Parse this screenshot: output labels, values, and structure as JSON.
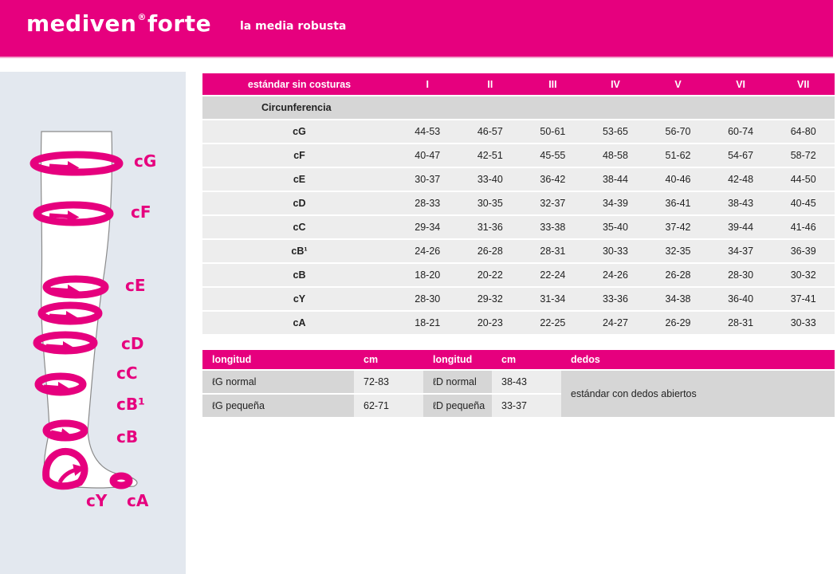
{
  "header": {
    "brand_main": "mediven",
    "brand_mark": "®",
    "brand_sub": "forte",
    "tagline": "la media robusta",
    "accent_color": "#e6007e"
  },
  "leg_labels": [
    "cG",
    "cF",
    "cE",
    "cD",
    "cC",
    "cB¹",
    "cB",
    "cY",
    "cA"
  ],
  "size_table": {
    "header_label": "estándar sin costuras",
    "sizes": [
      "I",
      "II",
      "III",
      "IV",
      "V",
      "VI",
      "VII"
    ],
    "section_title": "Circunferencia",
    "rows": [
      {
        "label": "cG",
        "values": [
          "44-53",
          "46-57",
          "50-61",
          "53-65",
          "56-70",
          "60-74",
          "64-80"
        ]
      },
      {
        "label": "cF",
        "values": [
          "40-47",
          "42-51",
          "45-55",
          "48-58",
          "51-62",
          "54-67",
          "58-72"
        ]
      },
      {
        "label": "cE",
        "values": [
          "30-37",
          "33-40",
          "36-42",
          "38-44",
          "40-46",
          "42-48",
          "44-50"
        ]
      },
      {
        "label": "cD",
        "values": [
          "28-33",
          "30-35",
          "32-37",
          "34-39",
          "36-41",
          "38-43",
          "40-45"
        ]
      },
      {
        "label": "cC",
        "values": [
          "29-34",
          "31-36",
          "33-38",
          "35-40",
          "37-42",
          "39-44",
          "41-46"
        ]
      },
      {
        "label": "cB¹",
        "values": [
          "24-26",
          "26-28",
          "28-31",
          "30-33",
          "32-35",
          "34-37",
          "36-39"
        ]
      },
      {
        "label": "cB",
        "values": [
          "18-20",
          "20-22",
          "22-24",
          "24-26",
          "26-28",
          "28-30",
          "30-32"
        ]
      },
      {
        "label": "cY",
        "values": [
          "28-30",
          "29-32",
          "31-34",
          "33-36",
          "34-38",
          "36-40",
          "37-41"
        ]
      },
      {
        "label": "cA",
        "values": [
          "18-21",
          "20-23",
          "22-25",
          "24-27",
          "26-29",
          "28-31",
          "30-33"
        ]
      }
    ]
  },
  "length_table": {
    "headers": [
      "longitud",
      "cm",
      "longitud",
      "cm",
      "dedos"
    ],
    "rows": [
      {
        "label1": "ℓG normal",
        "cm1": "72-83",
        "label2": "ℓD normal",
        "cm2": "38-43"
      },
      {
        "label1": "ℓG pequeña",
        "cm1": "62-71",
        "label2": "ℓD pequeña",
        "cm2": "33-37"
      }
    ],
    "toe_text": "estándar con dedos abiertos"
  }
}
